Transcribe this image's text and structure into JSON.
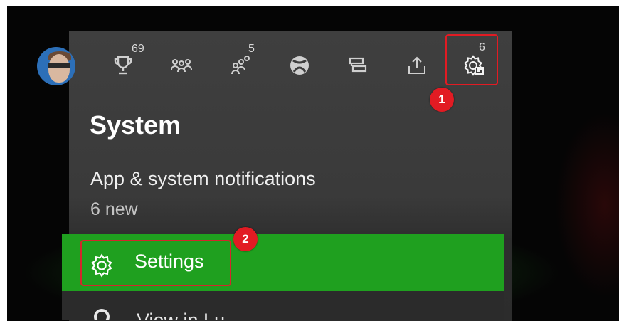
{
  "topbar": {
    "achievements_count": "69",
    "followers_count": "5",
    "notifications_count": "6"
  },
  "panel": {
    "title": "System",
    "notifications": {
      "label": "App & system notifications",
      "count": "6 new"
    },
    "settings_label": "Settings",
    "next_item_label": "View in Lu"
  },
  "annotations": {
    "step1": "1",
    "step2": "2"
  },
  "icons": [
    "avatar",
    "trophy-icon",
    "friends-icon",
    "party-icon",
    "xbox-icon",
    "messages-icon",
    "share-icon",
    "gear-notification-icon",
    "settings-gear-icon"
  ],
  "colors": {
    "highlight_green": "#1fa01f",
    "annotation_red": "#e21b23",
    "panel_gray": "#3d3d3d"
  }
}
